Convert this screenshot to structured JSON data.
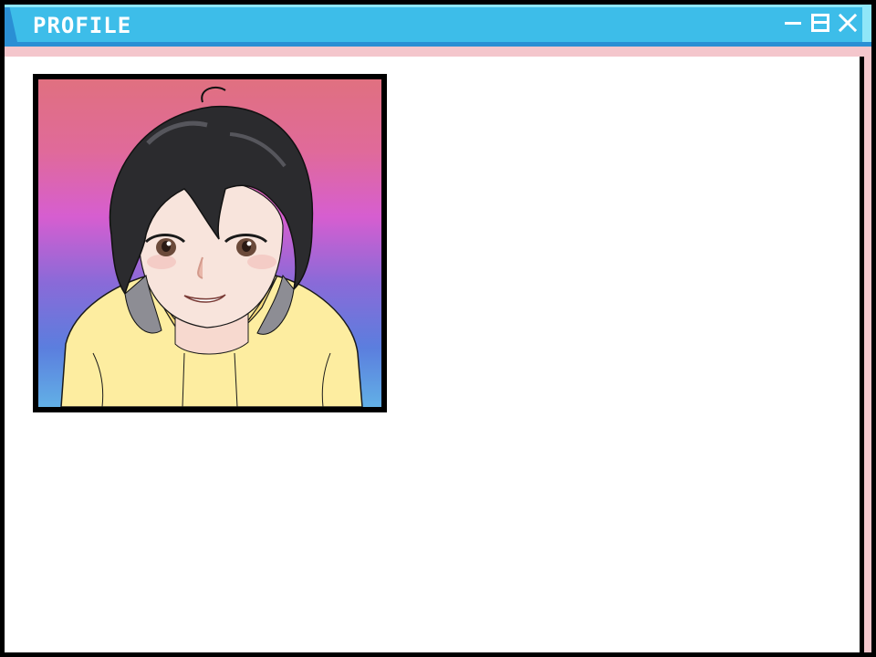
{
  "window": {
    "title": "PROFILE",
    "controls": {
      "minimize": "minimize",
      "maximize": "maximize",
      "close": "close"
    },
    "colors": {
      "titlebar": "#3dbde9",
      "titlebar_shadow": "#2a8fd4",
      "frame_accent": "#f4c6cc",
      "content_bg": "#ffffff"
    }
  },
  "profile": {
    "portrait_icon": "character-portrait"
  }
}
